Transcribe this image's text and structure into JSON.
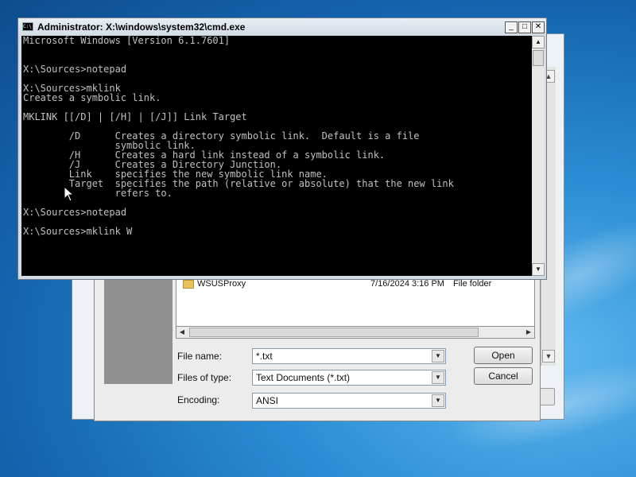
{
  "cmd": {
    "title": "Administrator: X:\\windows\\system32\\cmd.exe",
    "icon_text": "C:\\",
    "icon": "cmd-icon",
    "buttons": {
      "minimize": "_",
      "maximize": "□",
      "close": "✕"
    },
    "lines": [
      "Microsoft Windows [Version 6.1.7601]",
      "",
      "",
      "X:\\Sources>notepad",
      "",
      "X:\\Sources>mklink",
      "Creates a symbolic link.",
      "",
      "MKLINK [[/D] | [/H] | [/J]] Link Target",
      "",
      "        /D      Creates a directory symbolic link.  Default is a file",
      "                symbolic link.",
      "        /H      Creates a hard link instead of a symbolic link.",
      "        /J      Creates a Directory Junction.",
      "        Link    specifies the new symbolic link name.",
      "        Target  specifies the path (relative or absolute) that the new link",
      "                refers to.",
      "",
      "X:\\Sources>notepad",
      "",
      "X:\\Sources>mklink W"
    ],
    "scroll": {
      "up": "▲",
      "down": "▼"
    }
  },
  "dialog": {
    "file_row": {
      "name": "WSUSProxy",
      "date": "7/16/2024 3:16 PM",
      "type": "File folder"
    },
    "file_name_label": "File name:",
    "file_name_value": "*.txt",
    "files_of_type_label": "Files of type:",
    "files_of_type_value": "Text Documents (*.txt)",
    "encoding_label": "Encoding:",
    "encoding_value": "ANSI",
    "open_label": "Open",
    "cancel_label": "Cancel",
    "dropdown_glyph": "▼",
    "hscroll": {
      "left": "◀",
      "right": "▶"
    }
  },
  "notepad": {
    "scroll": {
      "up": "▲",
      "down": "▼"
    }
  }
}
